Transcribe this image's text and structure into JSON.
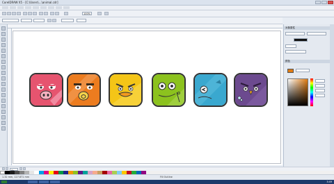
{
  "window": {
    "title": "CorelDRAW X5 - [C:\\Users\\...\\animal.cdr]"
  },
  "toolbar": {
    "zoom": "100%"
  },
  "docker": {
    "section1": "对象属性",
    "section2": "颜色",
    "current_color": "#e07b12"
  },
  "canvas": {
    "tiles": [
      {
        "name": "pig",
        "color": "#e6546f"
      },
      {
        "name": "monkey",
        "color": "#ec7c1f"
      },
      {
        "name": "chick",
        "color": "#f4c517"
      },
      {
        "name": "frog",
        "color": "#8cc21e"
      },
      {
        "name": "fish",
        "color": "#3aa8cf"
      },
      {
        "name": "owl",
        "color": "#6c4a8f"
      }
    ]
  },
  "pages": {
    "current": "页1"
  },
  "status": {
    "left": "1.32 mm, 127.871 mm",
    "middle": "Fill  Outline",
    "time": "3:49"
  }
}
